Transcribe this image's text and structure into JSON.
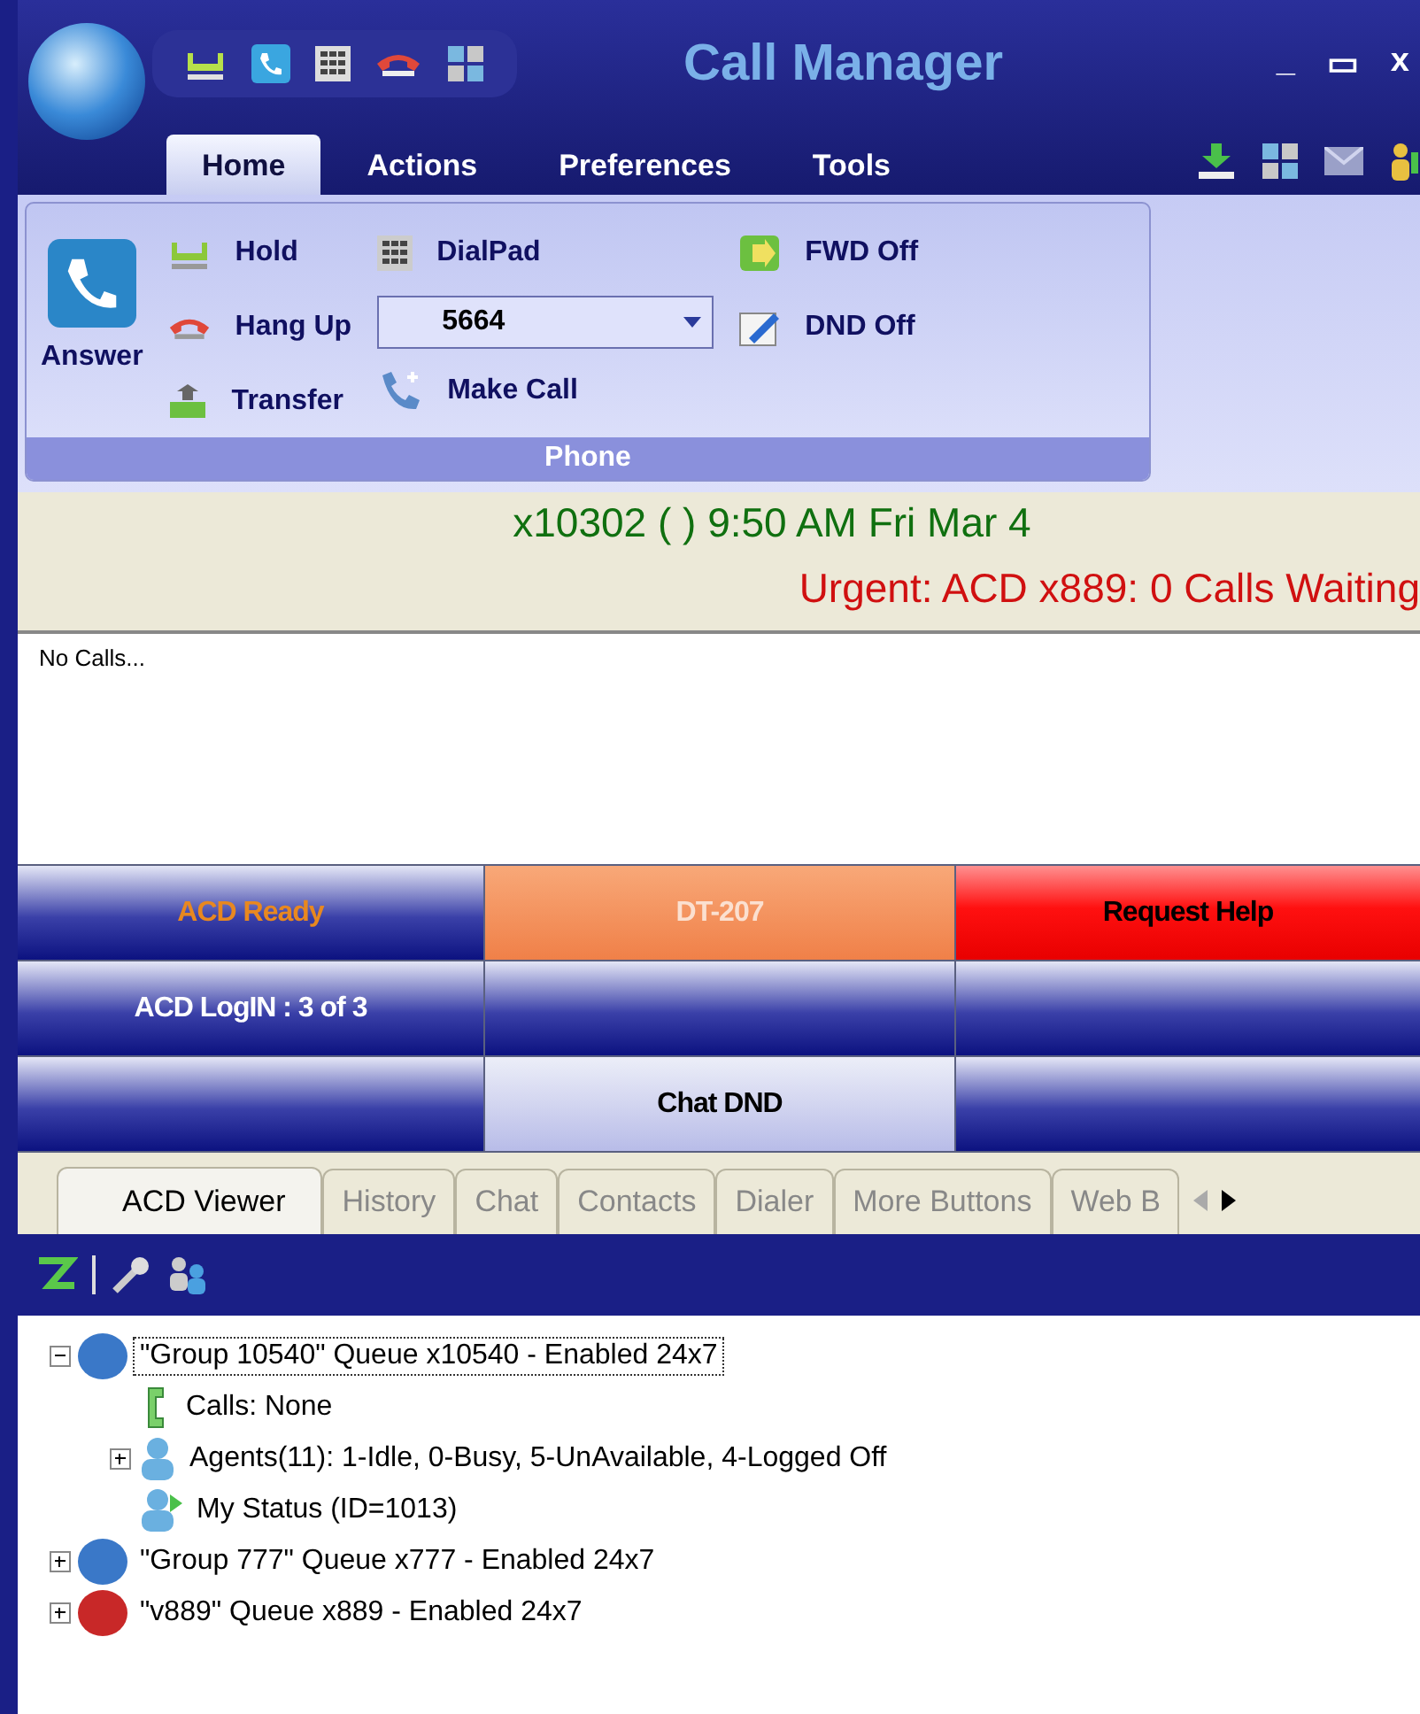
{
  "window": {
    "title": "Call Manager",
    "controls": [
      "_",
      "▭",
      "x"
    ]
  },
  "ribbon_tabs": [
    {
      "label": "Home",
      "selected": true
    },
    {
      "label": "Actions",
      "selected": false
    },
    {
      "label": "Preferences",
      "selected": false
    },
    {
      "label": "Tools",
      "selected": false
    }
  ],
  "phone_group": {
    "answer": "Answer",
    "col1": [
      "Hold",
      "Hang Up",
      "Transfer"
    ],
    "dialpad": "DialPad",
    "number": "5664",
    "make_call": "Make Call",
    "fwd": "FWD Off",
    "dnd": "DND Off",
    "label": "Phone"
  },
  "status": {
    "line1": "x10302 ( )  9:50 AM Fri Mar 4",
    "line2": "Urgent: ACD x889: 0 Calls Waiting"
  },
  "calls_panel": {
    "text": "No Calls..."
  },
  "buttons": [
    {
      "label": "ACD Ready",
      "kind": "ready"
    },
    {
      "label": "DT-207",
      "kind": "orange"
    },
    {
      "label": "Request Help",
      "kind": "red"
    },
    {
      "label": "ACD LogIN : 3 of 3",
      "kind": "plain"
    },
    {
      "kind": "plain"
    },
    {
      "kind": "plain"
    },
    {
      "kind": "plain"
    },
    {
      "label": "Chat DND",
      "kind": "light"
    },
    {
      "kind": "plain"
    }
  ],
  "bottom_tabs": [
    {
      "label": "ACD Viewer",
      "selected": true
    },
    {
      "label": "History",
      "selected": false
    },
    {
      "label": "Chat",
      "selected": false
    },
    {
      "label": "Contacts",
      "selected": false
    },
    {
      "label": "Dialer",
      "selected": false
    },
    {
      "label": "More Buttons",
      "selected": false
    },
    {
      "label": "Web B",
      "selected": false
    }
  ],
  "tree": [
    {
      "label": "\"Group 10540\" Queue x10540 - Enabled 24x7",
      "kind": "queue",
      "color": "#3a78c8",
      "expanded": true,
      "selected": true,
      "children": [
        {
          "label": "Calls:  None",
          "kind": "calls",
          "selected": false
        },
        {
          "label": "Agents(11):  1-Idle, 0-Busy, 5-UnAvailable, 4-Logged  Off",
          "kind": "agents",
          "expanded": false,
          "selected": false
        },
        {
          "label": "My Status (ID=1013)",
          "kind": "status",
          "selected": false
        }
      ]
    },
    {
      "label": "\"Group 777\" Queue x777 - Enabled 24x7",
      "kind": "queue",
      "color": "#3a78c8",
      "expanded": false,
      "selected": false
    },
    {
      "label": "\"v889\" Queue x889 - Enabled 24x7",
      "kind": "queue",
      "color": "#c82828",
      "expanded": false,
      "selected": false
    }
  ]
}
